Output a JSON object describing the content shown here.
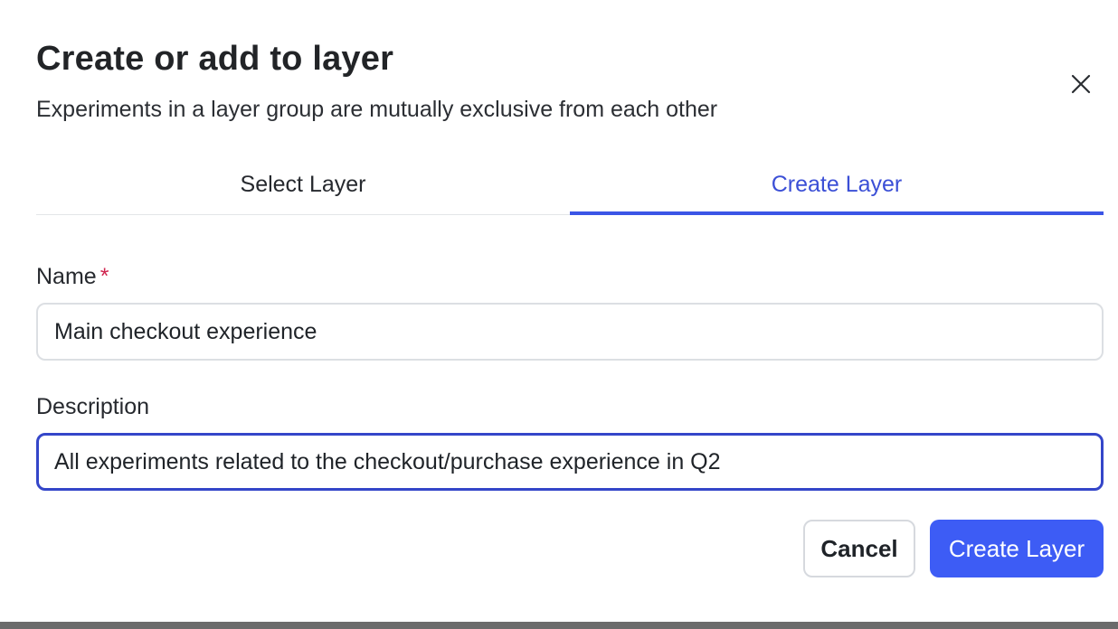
{
  "dialog": {
    "title": "Create or add to layer",
    "subtitle": "Experiments in a layer group are mutually exclusive from each other",
    "close_icon": "close-icon"
  },
  "tabs": [
    {
      "label": "Select Layer",
      "active": false
    },
    {
      "label": "Create Layer",
      "active": true
    }
  ],
  "form": {
    "name_label": "Name",
    "name_required_marker": "*",
    "name_value": "Main checkout experience",
    "description_label": "Description",
    "description_value": "All experiments related to the checkout/purchase experience in Q2"
  },
  "actions": {
    "cancel_label": "Cancel",
    "submit_label": "Create Layer"
  },
  "colors": {
    "accent": "#3d5cf5",
    "active_tab": "#3b4fd6",
    "required": "#d0264f"
  }
}
